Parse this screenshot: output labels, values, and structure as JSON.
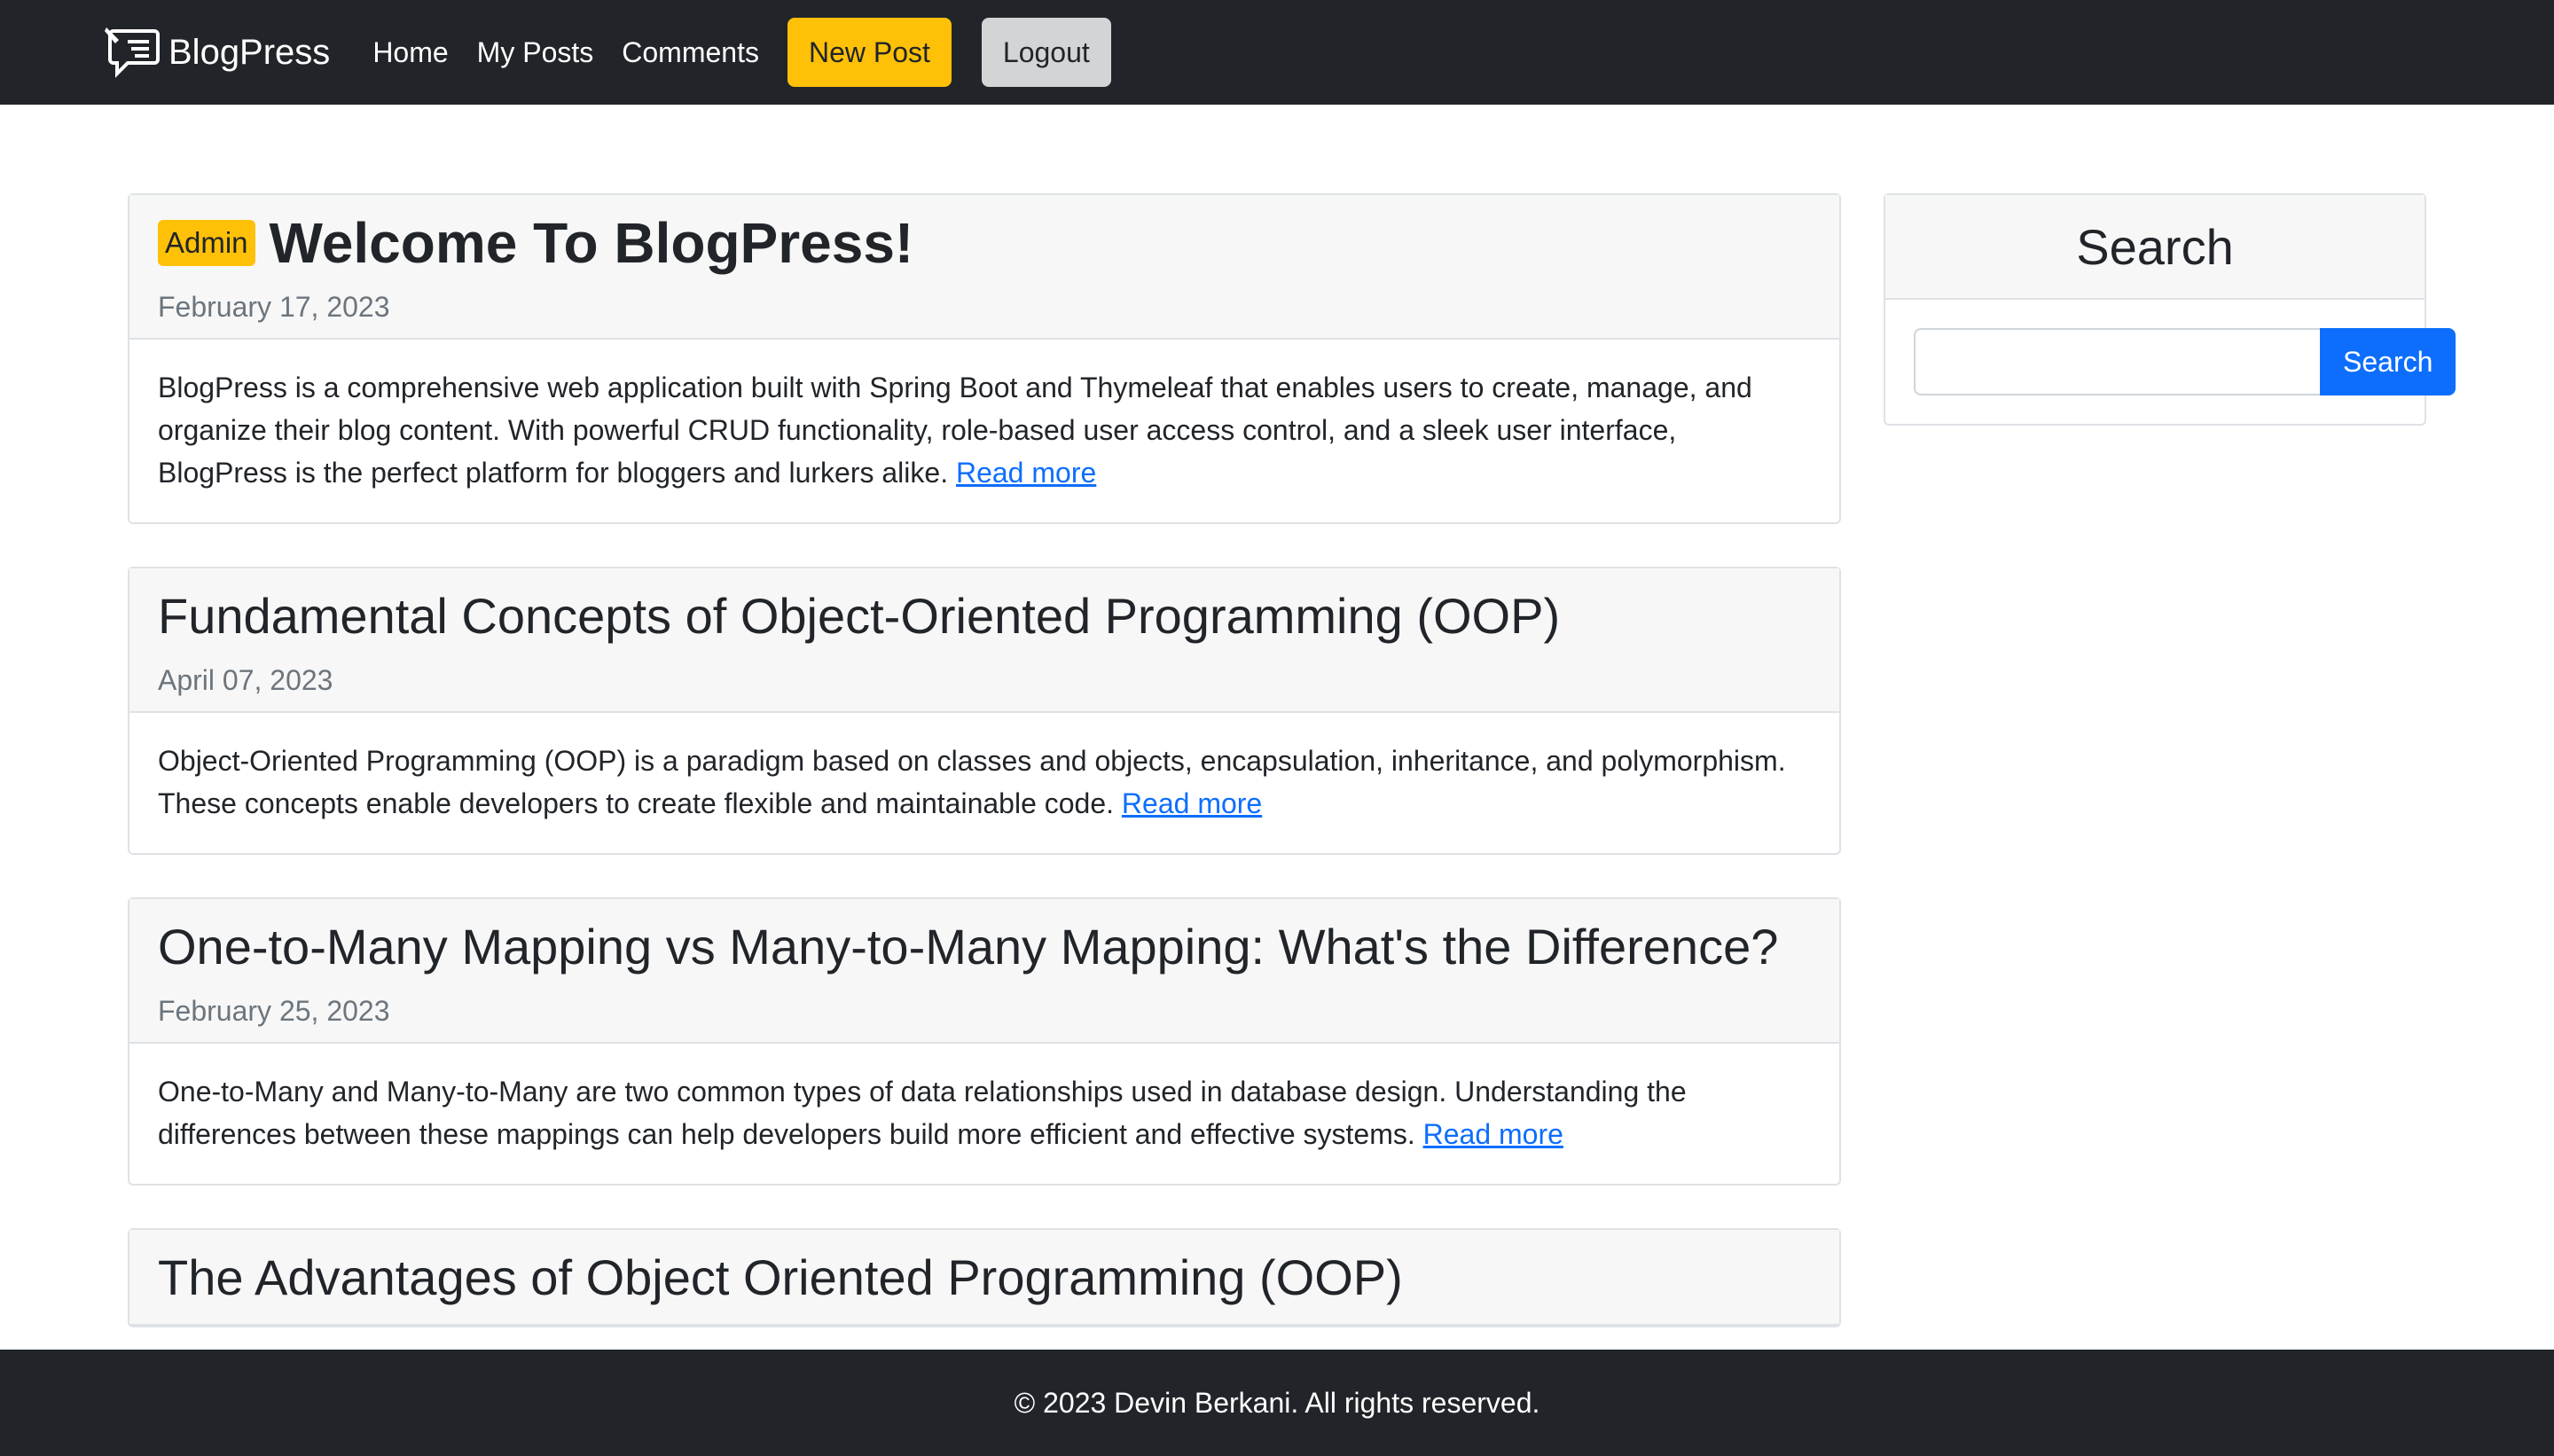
{
  "navbar": {
    "brand": "BlogPress",
    "brand_icon": "chat-bubble-pen-icon",
    "links": [
      "Home",
      "My Posts",
      "Comments"
    ],
    "new_post_label": "New Post",
    "logout_label": "Logout"
  },
  "posts": [
    {
      "badge": "Admin",
      "title": "Welcome To BlogPress!",
      "date": "February 17, 2023",
      "excerpt": "BlogPress is a comprehensive web application built with Spring Boot and Thymeleaf that enables users to create, manage, and organize their blog content. With powerful CRUD functionality, role-based user access control, and a sleek user interface, BlogPress is the perfect platform for bloggers and lurkers alike.",
      "read_more": "Read more"
    },
    {
      "title": "Fundamental Concepts of Object-Oriented Programming (OOP)",
      "date": "April 07, 2023",
      "excerpt": "Object-Oriented Programming (OOP) is a paradigm based on classes and objects, encapsulation, inheritance, and polymorphism. These concepts enable developers to create flexible and maintainable code.",
      "read_more": "Read more"
    },
    {
      "title": "One-to-Many Mapping vs Many-to-Many Mapping: What's the Difference?",
      "date": "February 25, 2023",
      "excerpt": "One-to-Many and Many-to-Many are two common types of data relationships used in database design. Understanding the differences between these mappings can help developers build more efficient and effective systems.",
      "read_more": "Read more"
    },
    {
      "title": "The Advantages of Object Oriented Programming (OOP)"
    }
  ],
  "sidebar": {
    "search_title": "Search",
    "search_value": "",
    "search_button": "Search"
  },
  "footer": {
    "text": "© 2023 Devin Berkani. All rights reserved."
  },
  "colors": {
    "navbar_bg": "#212529",
    "accent_yellow": "#ffc107",
    "primary_blue": "#0d6efd",
    "muted_text": "#6c757d"
  }
}
